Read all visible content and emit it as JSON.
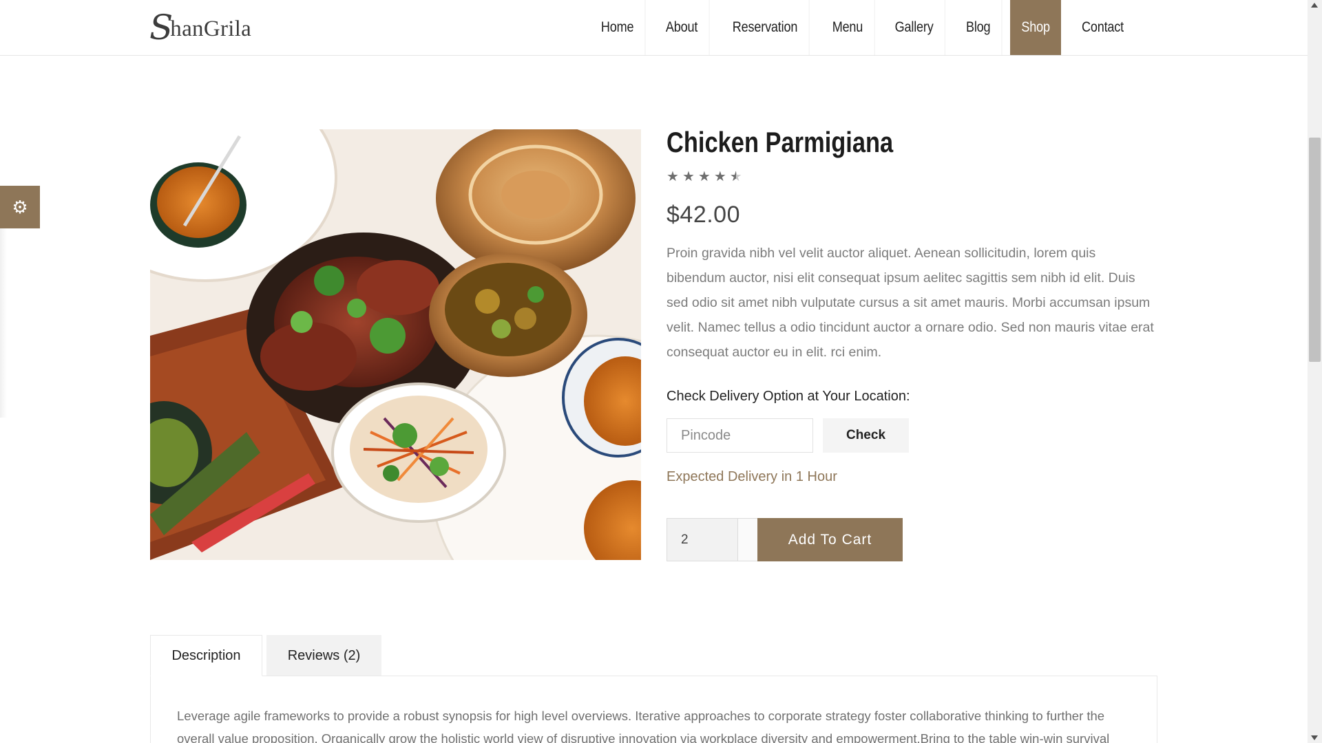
{
  "header": {
    "logo_initial": "S",
    "logo_text": "hanGrila",
    "nav": [
      {
        "label": "Home"
      },
      {
        "label": "About"
      },
      {
        "label": "Reservation"
      },
      {
        "label": "Menu"
      },
      {
        "label": "Gallery"
      },
      {
        "label": "Blog"
      },
      {
        "label": "Shop"
      },
      {
        "label": "Contact"
      }
    ],
    "active_nav": "Shop"
  },
  "settings": {
    "icon": "gear-icon"
  },
  "product": {
    "image_alt": "Plated Indian dishes",
    "title": "Chicken Parmigiana",
    "rating": 4.5,
    "rating_max": 5,
    "price": "$42.00",
    "description": "Proin gravida nibh vel velit auctor aliquet. Aenean sollicitudin, lorem quis bibendum auctor, nisi elit consequat ipsum aelitec sagittis sem nibh id elit. Duis sed odio sit amet nibh vulputate cursus a sit amet mauris. Morbi accumsan ipsum velit. Namec tellus a odio tincidunt auctor a ornare odio. Sed non mauris vitae erat consequat auctor eu in elit. rci enim.",
    "delivery": {
      "label": "Check Delivery Option at Your Location:",
      "pincode_placeholder": "Pincode",
      "pincode_value": "",
      "check_label": "Check",
      "status": "Expected Delivery in 1 Hour"
    },
    "quantity": "2",
    "add_to_cart_label": "Add To Cart"
  },
  "tabs": {
    "items": [
      {
        "label": "Description"
      },
      {
        "label": "Reviews (2)"
      }
    ],
    "active": "Description",
    "description_text": "Leverage agile frameworks to provide a robust synopsis for high level overviews. Iterative approaches to corporate strategy foster collaborative thinking to further the overall value proposition. Organically grow the holistic world view of disruptive innovation via workplace diversity and empowerment.Bring to the table win-win survival"
  },
  "colors": {
    "accent": "#8e7658",
    "text_dark": "#1c1c1c",
    "text_muted": "#7b7b7b"
  }
}
